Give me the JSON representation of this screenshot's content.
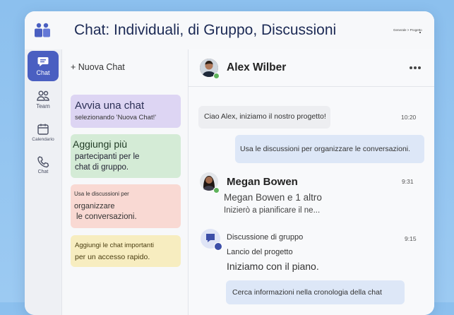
{
  "window": {
    "title": "Chat: Individuali, di Gruppo, Discussioni",
    "subtitle": "Generale > Progetto"
  },
  "rail": {
    "items": [
      {
        "label": "Chat",
        "icon": "chat-icon",
        "active": true
      },
      {
        "label": "Team",
        "icon": "team-icon"
      },
      {
        "label": "Calendario",
        "icon": "calendar-icon"
      },
      {
        "label": "Chat",
        "icon": "call-icon"
      }
    ]
  },
  "chat_list": {
    "new_chat_label": "+ Nuova Chat",
    "cards": [
      {
        "line1": "Avvia una chat",
        "line2": "selezionando 'Nuova Chat!'",
        "color": "#ddd5f3"
      },
      {
        "line1": "Aggiungi più",
        "line2": "partecipanti per le",
        "line3": "chat di gruppo.",
        "color": "#d4ebd6"
      },
      {
        "line1": "Usa le discussioni per",
        "line2": "organizzare",
        "line3": "le conversazioni.",
        "color": "#f9d9d3"
      },
      {
        "line1": "Aggiungi le chat importanti",
        "line2": "per un accesso rapido.",
        "color": "#f7edc0"
      }
    ]
  },
  "conversation": {
    "contact_name": "Alex Wilber",
    "more_icon": "more-icon",
    "messages": [
      {
        "text": "Ciao Alex, iniziamo il nostro progetto!",
        "time": "10:20"
      },
      {
        "text": "Usa le discussioni per organizzare le conversazioni."
      }
    ],
    "group_chat": {
      "name": "Megan Bowen",
      "time": "9:31",
      "members": "Megan Bowen e 1 altro",
      "preview": "Inizierò a pianificare il ne..."
    },
    "discussion": {
      "label": "Discussione di gruppo",
      "time": "9:15",
      "project": "Lancio del progetto",
      "message": "Iniziamo con il piano.",
      "search_hint": "Cerca informazioni nella cronologia della chat"
    }
  },
  "colors": {
    "accent": "#4a5fc1",
    "presence": "#5fb35c"
  }
}
